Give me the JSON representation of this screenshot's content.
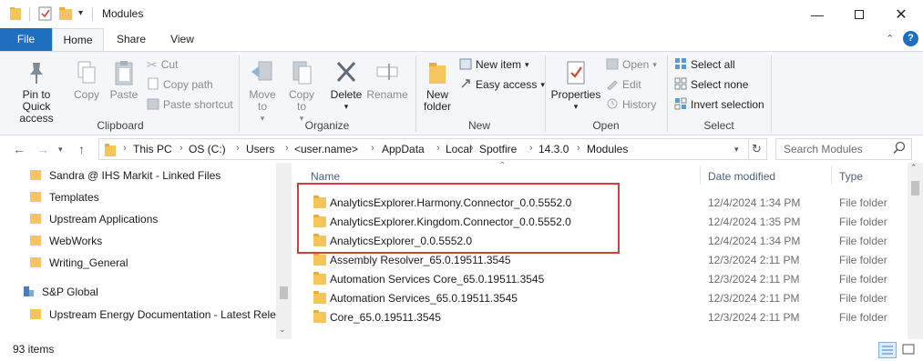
{
  "window": {
    "title": "Modules",
    "controls": [
      "minimize",
      "maximize",
      "close"
    ]
  },
  "ribbon": {
    "tabs": [
      "File",
      "Home",
      "Share",
      "View"
    ],
    "active_tab": "Home",
    "clipboard": {
      "label": "Clipboard",
      "pin": "Pin to Quick access",
      "copy": "Copy",
      "paste": "Paste",
      "cut": "Cut",
      "copy_path": "Copy path",
      "paste_shortcut": "Paste shortcut"
    },
    "organize": {
      "label": "Organize",
      "move_to": "Move to",
      "copy_to": "Copy to",
      "delete": "Delete",
      "rename": "Rename"
    },
    "new": {
      "label": "New",
      "new_folder": "New folder",
      "new_item": "New item",
      "easy_access": "Easy access"
    },
    "open": {
      "label": "Open",
      "properties": "Properties",
      "open": "Open",
      "edit": "Edit",
      "history": "History"
    },
    "select": {
      "label": "Select",
      "select_all": "Select all",
      "select_none": "Select none",
      "invert": "Invert selection"
    }
  },
  "address": {
    "crumbs": [
      "This PC",
      "OS (C:)",
      "Users",
      "<user.name>",
      "AppData",
      "Local",
      "Spotfire",
      "14.3.0",
      "Modules"
    ],
    "search_placeholder": "Search Modules"
  },
  "navpane": {
    "items": [
      "Sandra @ IHS Markit - Linked Files",
      "Templates",
      "Upstream Applications",
      "WebWorks",
      "Writing_General",
      "S&P Global",
      "Upstream Energy Documentation - Latest Relea"
    ]
  },
  "filelist": {
    "columns": {
      "name": "Name",
      "date": "Date modified",
      "type": "Type"
    },
    "rows": [
      {
        "name": "AnalyticsExplorer.Harmony.Connector_0.0.5552.0",
        "date": "12/4/2024 1:34 PM",
        "type": "File folder"
      },
      {
        "name": "AnalyticsExplorer.Kingdom.Connector_0.0.5552.0",
        "date": "12/4/2024 1:35 PM",
        "type": "File folder"
      },
      {
        "name": "AnalyticsExplorer_0.0.5552.0",
        "date": "12/4/2024 1:34 PM",
        "type": "File folder"
      },
      {
        "name": "Assembly Resolver_65.0.19511.3545",
        "date": "12/3/2024 2:11 PM",
        "type": "File folder"
      },
      {
        "name": "Automation Services Core_65.0.19511.3545",
        "date": "12/3/2024 2:11 PM",
        "type": "File folder"
      },
      {
        "name": "Automation Services_65.0.19511.3545",
        "date": "12/3/2024 2:11 PM",
        "type": "File folder"
      },
      {
        "name": "Core_65.0.19511.3545",
        "date": "12/3/2024 2:11 PM",
        "type": "File folder"
      }
    ]
  },
  "status": {
    "item_count": "93 items"
  }
}
